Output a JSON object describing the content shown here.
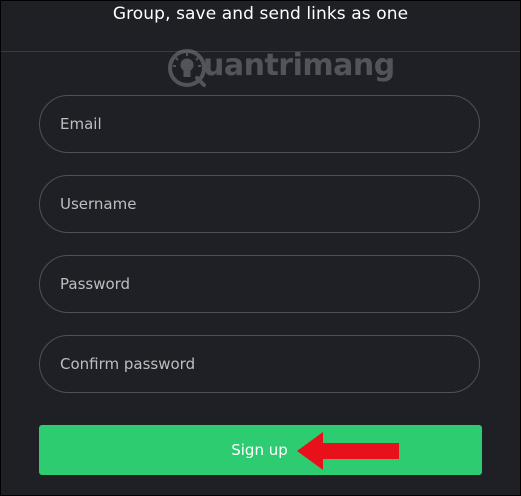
{
  "header": {
    "tagline": "Group, save and send links as one"
  },
  "watermark": {
    "text": "uantrimang",
    "icon": "lightbulb-icon"
  },
  "form": {
    "email": {
      "placeholder": "Email",
      "value": ""
    },
    "username": {
      "placeholder": "Username",
      "value": ""
    },
    "password": {
      "placeholder": "Password",
      "value": ""
    },
    "confirm_password": {
      "placeholder": "Confirm password",
      "value": ""
    },
    "submit_label": "Sign up"
  },
  "annotation": {
    "icon": "arrow-left-icon",
    "color": "#e8111b"
  },
  "colors": {
    "background": "#1f2025",
    "field_border": "#505156",
    "button": "#2ecc71",
    "text": "#ffffff"
  }
}
